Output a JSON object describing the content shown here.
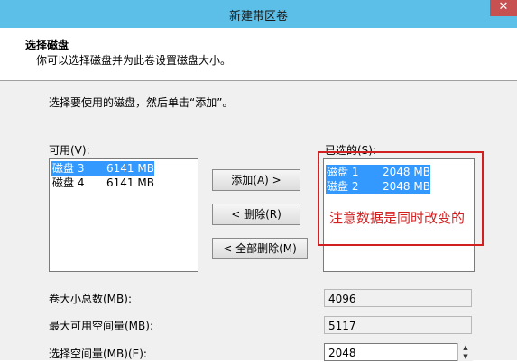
{
  "window": {
    "title": "新建带区卷",
    "close_label": "✕"
  },
  "header": {
    "title": "选择磁盘",
    "description": "你可以选择磁盘并为此卷设置磁盘大小。"
  },
  "instruction": "选择要使用的磁盘，然后单击“添加”。",
  "available": {
    "label": "可用(V):",
    "items": [
      {
        "name": "磁盘 3",
        "size": "6141 MB",
        "selected": true
      },
      {
        "name": "磁盘 4",
        "size": "6141 MB",
        "selected": false
      }
    ]
  },
  "selected_list": {
    "label": "已选的(S):",
    "items": [
      {
        "name": "磁盘 1",
        "size": "2048 MB",
        "selected": true
      },
      {
        "name": "磁盘 2",
        "size": "2048 MB",
        "selected": true
      }
    ]
  },
  "buttons": {
    "add": "添加(A) >",
    "remove": "< 删除(R)",
    "remove_all": "< 全部删除(M)"
  },
  "annotation": {
    "text": "注意数据是同时改变的",
    "color": "#d21f1f"
  },
  "fields": {
    "total_label": "卷大小总数(MB):",
    "total_value": "4096",
    "max_label": "最大可用空间量(MB):",
    "max_value": "5117",
    "choose_label": "选择空间量(MB)(E):",
    "choose_value": "2048"
  },
  "colors": {
    "titlebar": "#5bbfe8",
    "selection": "#3399ff",
    "close": "#c75050"
  }
}
